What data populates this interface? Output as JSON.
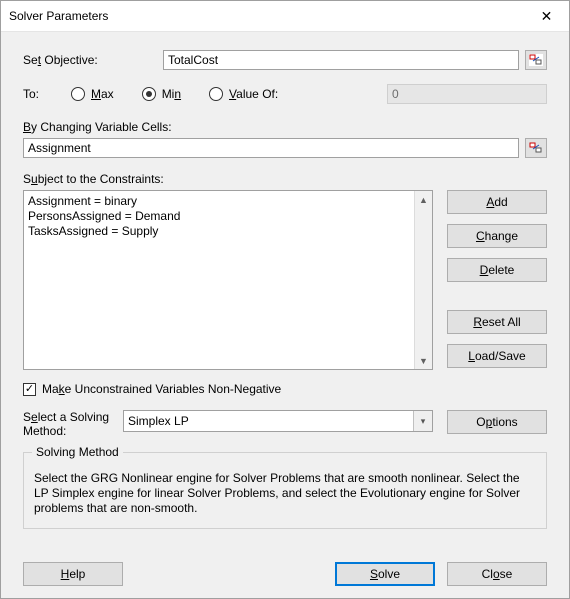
{
  "window": {
    "title": "Solver Parameters",
    "close_glyph": "✕"
  },
  "objective": {
    "label_pre": "Se",
    "label_u": "t",
    "label_post": " Objective:",
    "value": "TotalCost"
  },
  "to": {
    "label": "To:",
    "max_u": "M",
    "max_post": "ax",
    "min_pre": "Mi",
    "min_u": "n",
    "valueof_u": "V",
    "valueof_post": "alue Of:",
    "valueof_value": "0",
    "selected": "min"
  },
  "changing": {
    "label_u": "B",
    "label_post": "y Changing Variable Cells:",
    "value": "Assignment"
  },
  "constraints": {
    "label_pre": "S",
    "label_u": "u",
    "label_post": "bject to the Constraints:",
    "lines": [
      "Assignment = binary",
      "PersonsAssigned = Demand",
      "TasksAssigned = Supply"
    ]
  },
  "side_buttons": {
    "add_u": "A",
    "add_post": "dd",
    "change_u": "C",
    "change_post": "hange",
    "delete_u": "D",
    "delete_post": "elete",
    "reset_u": "R",
    "reset_post": "eset All",
    "load_u": "L",
    "load_post": "oad/Save"
  },
  "checkbox": {
    "checked": true,
    "label_pre": "Ma",
    "label_u": "k",
    "label_post": "e Unconstrained Variables Non-Negative"
  },
  "method": {
    "label_pre": "S",
    "label_u": "e",
    "label_post": "lect a Solving Method:",
    "value": "Simplex LP",
    "options_pre": "O",
    "options_u": "p",
    "options_post": "tions"
  },
  "groupbox": {
    "legend": "Solving Method",
    "text": "Select the GRG Nonlinear engine for Solver Problems that are smooth nonlinear. Select the LP Simplex engine for linear Solver Problems, and select the Evolutionary engine for Solver problems that are non-smooth."
  },
  "footer": {
    "help_u": "H",
    "help_post": "elp",
    "solve_u": "S",
    "solve_post": "olve",
    "close_pre": "Cl",
    "close_u": "o",
    "close_post": "se"
  }
}
